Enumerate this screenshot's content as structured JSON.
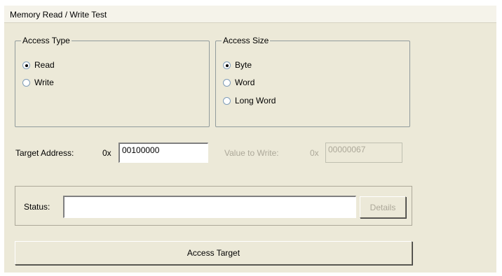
{
  "tab": {
    "title": "Memory Read / Write Test"
  },
  "access_type": {
    "legend": "Access Type",
    "options": [
      {
        "label": "Read",
        "checked": true
      },
      {
        "label": "Write",
        "checked": false
      }
    ]
  },
  "access_size": {
    "legend": "Access Size",
    "options": [
      {
        "label": "Byte",
        "checked": true
      },
      {
        "label": "Word",
        "checked": false
      },
      {
        "label": "Long Word",
        "checked": false
      }
    ]
  },
  "target_address": {
    "label": "Target Address:",
    "prefix": "0x",
    "value": "00100000"
  },
  "value_to_write": {
    "label": "Value to Write:",
    "prefix": "0x",
    "value": "00000067",
    "disabled": true
  },
  "status": {
    "label": "Status:",
    "value": "",
    "details_label": "Details"
  },
  "access_button": {
    "label": "Access Target"
  }
}
